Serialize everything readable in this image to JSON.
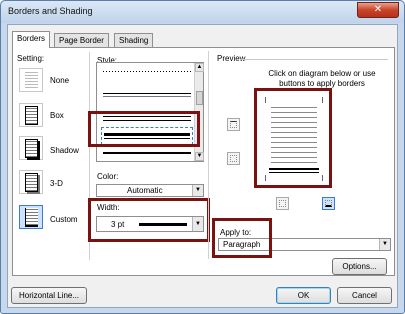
{
  "window": {
    "title": "Borders and Shading",
    "close_glyph": "✕"
  },
  "tabs": [
    {
      "label": "Borders",
      "active": true
    },
    {
      "label": "Page Border",
      "active": false
    },
    {
      "label": "Shading",
      "active": false
    }
  ],
  "setting": {
    "label": "Setting:",
    "options": [
      "None",
      "Box",
      "Shadow",
      "3-D",
      "Custom"
    ],
    "selected": "Custom"
  },
  "style": {
    "label": "Style:"
  },
  "color": {
    "label": "Color:",
    "value": "Automatic"
  },
  "width": {
    "label": "Width:",
    "value": "3 pt"
  },
  "preview": {
    "group_label": "Preview",
    "hint_line1": "Click on diagram below or use",
    "hint_line2": "buttons to apply borders"
  },
  "apply_to": {
    "label": "Apply to:",
    "value": "Paragraph"
  },
  "buttons": {
    "options": "Options...",
    "horizontal_line": "Horizontal Line...",
    "ok": "OK",
    "cancel": "Cancel"
  },
  "colors": {
    "highlight": "#7b1212",
    "accent": "#3a7bd5"
  }
}
